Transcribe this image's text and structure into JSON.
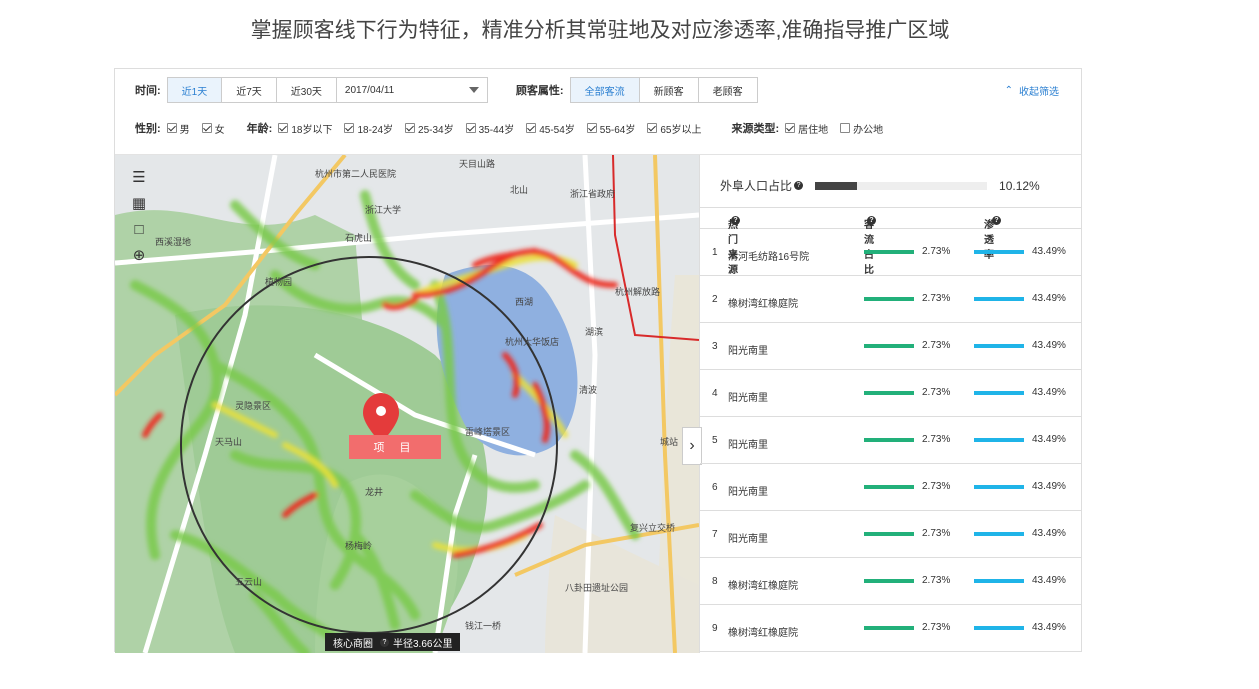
{
  "headline": "掌握顾客线下行为特征，精准分析其常驻地及对应渗透率,准确指导推广区域",
  "filters": {
    "time_label": "时间:",
    "time_options": [
      "近1天",
      "近7天",
      "近30天"
    ],
    "date_value": "2017/04/11",
    "customer_label": "顾客属性:",
    "customer_options": [
      "全部客流",
      "新顾客",
      "老顾客"
    ],
    "collapse_label": "收起筛选",
    "gender_label": "性别:",
    "genders": [
      "男",
      "女"
    ],
    "age_label": "年龄:",
    "ages": [
      "18岁以下",
      "18-24岁",
      "25-34岁",
      "35-44岁",
      "45-54岁",
      "55-64岁",
      "65岁以上"
    ],
    "source_label": "来源类型:",
    "sources": [
      {
        "label": "居住地",
        "checked": true
      },
      {
        "label": "办公地",
        "checked": false
      }
    ]
  },
  "map": {
    "project_label": "项 目",
    "radius_prefix": "核心商圈",
    "radius_text": "半径3.66公里",
    "place_names": [
      "天目山路",
      "杭州市第二人民医院",
      "浙江大学",
      "西溪湿地",
      "植物园",
      "杭州大华饭店",
      "湖滨",
      "杭州解放路",
      "清波",
      "雷峰塔景区",
      "灵隐景区",
      "天马山",
      "杨梅岭",
      "龙井",
      "八卦田遗址公园",
      "复兴立交桥",
      "钱江一桥",
      "五云山",
      "石虎山",
      "北山",
      "西湖",
      "浙江省政府",
      "城站"
    ]
  },
  "side": {
    "ratio_label": "外阜人口占比",
    "ratio_value": "10.12%",
    "ratio_fraction": 0.1012,
    "col_source": "热门来源",
    "col_share": "客流占比",
    "col_penetration": "渗透率",
    "rows": [
      {
        "rank": "1",
        "name": "清河毛纺路16号院",
        "share": "2.73%",
        "penetration": "43.49%"
      },
      {
        "rank": "2",
        "name": "橡树湾红橡庭院",
        "share": "2.73%",
        "penetration": "43.49%"
      },
      {
        "rank": "3",
        "name": "阳光南里",
        "share": "2.73%",
        "penetration": "43.49%"
      },
      {
        "rank": "4",
        "name": "阳光南里",
        "share": "2.73%",
        "penetration": "43.49%"
      },
      {
        "rank": "5",
        "name": "阳光南里",
        "share": "2.73%",
        "penetration": "43.49%"
      },
      {
        "rank": "6",
        "name": "阳光南里",
        "share": "2.73%",
        "penetration": "43.49%"
      },
      {
        "rank": "7",
        "name": "阳光南里",
        "share": "2.73%",
        "penetration": "43.49%"
      },
      {
        "rank": "8",
        "name": "橡树湾红橡庭院",
        "share": "2.73%",
        "penetration": "43.49%"
      },
      {
        "rank": "9",
        "name": "橡树湾红橡庭院",
        "share": "2.73%",
        "penetration": "43.49%"
      }
    ]
  },
  "colors": {
    "accent": "#2a7fd1",
    "share_bar": "#22b07a",
    "penetration_bar": "#1fb4e8",
    "project": "#f26d6d"
  }
}
